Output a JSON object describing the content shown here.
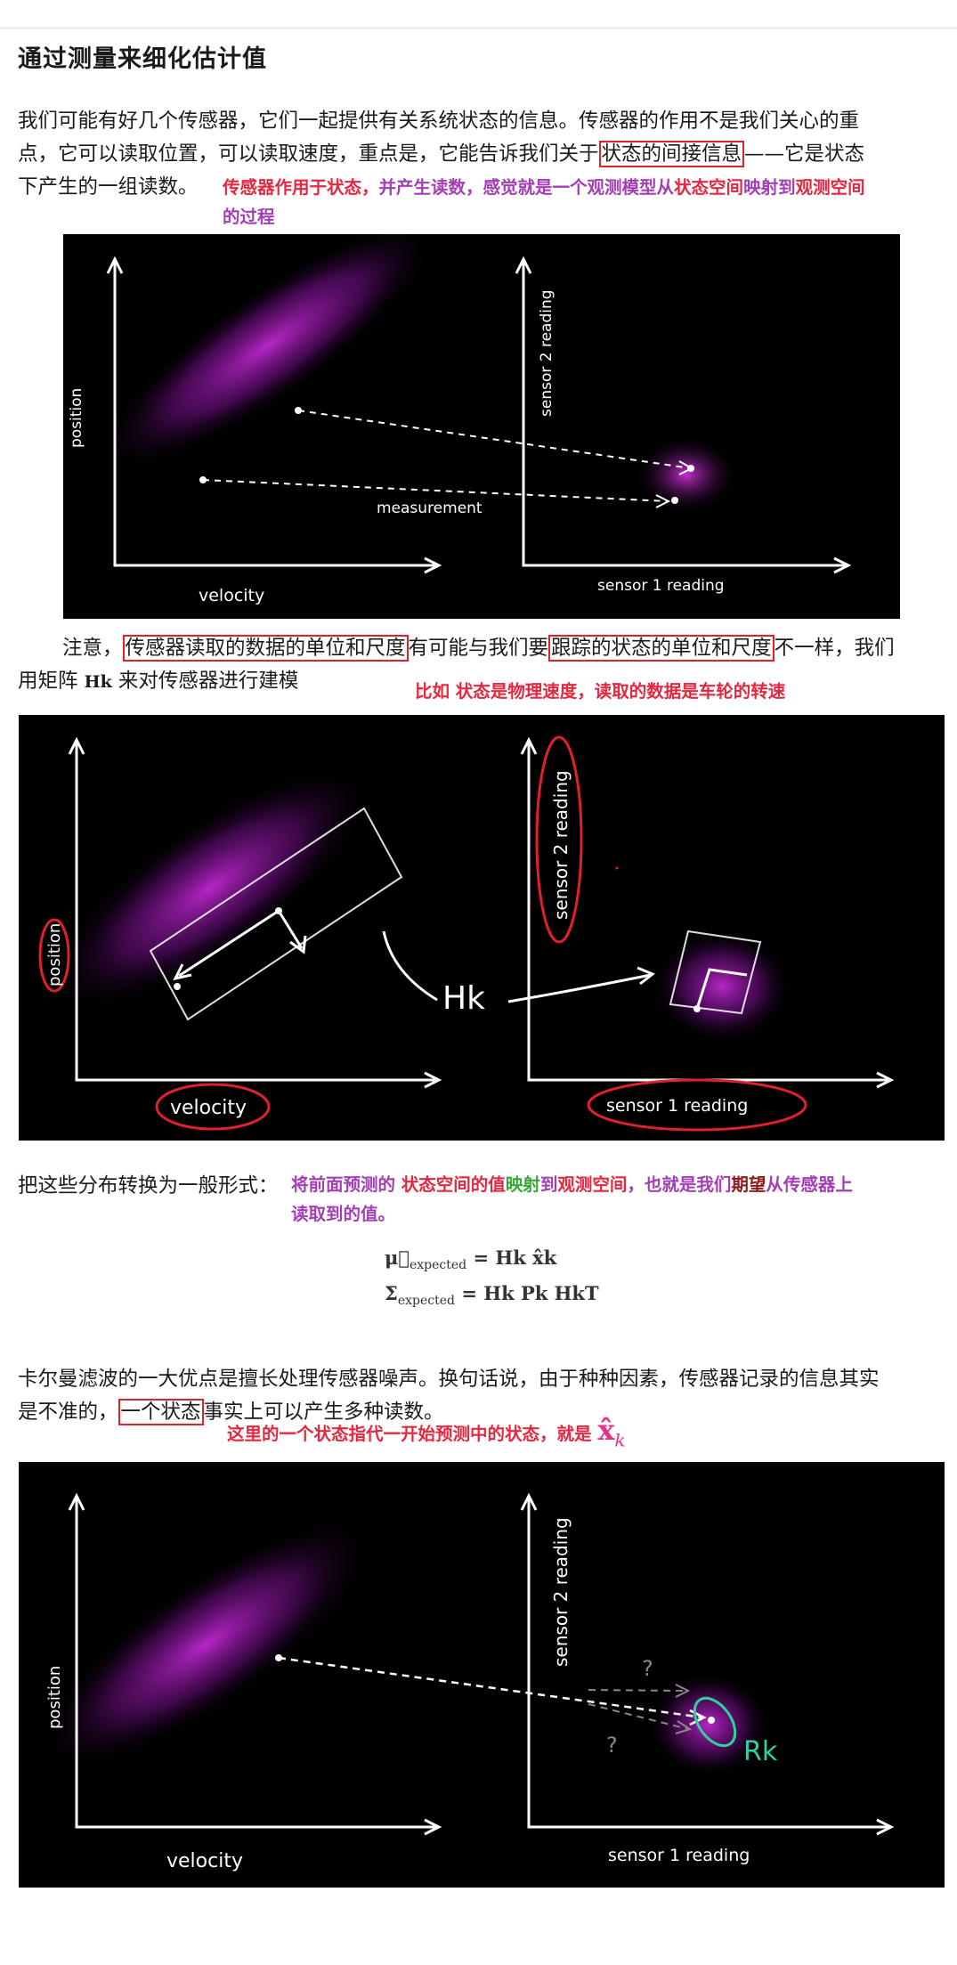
{
  "title": "通过测量来细化估计值",
  "para1": {
    "a": "我们可能有好几个传感器，它们一起提供有关系统状态的信息。传感器的作用不是我们关心的重",
    "b_pre": "点，它可以读取位置，可以读取速度，重点是，它能告诉我们关于",
    "b_box": "状态的间接信息",
    "b_post": "——它是状态",
    "c": "下产生的一组读数。"
  },
  "anno1": {
    "p1": "传感器作用于状态，",
    "p2": "并产生读数，",
    "p3": "感觉就是一个观测模型从",
    "p4": "状态空间",
    "p5": "映射到",
    "p6": "观测空间",
    "p7": "的过程"
  },
  "figure1": {
    "y_left": "position",
    "x_left": "velocity",
    "arrow_label": "measurement",
    "y_right": "sensor 2 reading",
    "x_right": "sensor 1 reading"
  },
  "para2": {
    "pre": "注意，",
    "box1": "传感器读取的数据的单位和尺度",
    "mid": "有可能与我们要",
    "box2": "跟踪的状态的单位和尺度",
    "post": "不一样，我们",
    "line2_pre": "用矩阵 ",
    "matrix": "Hk",
    "line2_post": " 来对传感器进行建模"
  },
  "anno2": "比如 状态是物理速度，读取的数据是车轮的转速",
  "figure2": {
    "y_left": "position",
    "x_left": "velocity",
    "transform_label": "Hk",
    "y_right": "sensor 2 reading",
    "x_right": "sensor 1 reading"
  },
  "para3": "把这些分布转换为一般形式：",
  "anno3": {
    "p1": "将前面预测的 ",
    "p2": "状态空间的值",
    "p3": "映射",
    "p4": "到",
    "p5": "观测空间",
    "p6": "，也就是我们",
    "p7": "期望",
    "p8": "从传感器上",
    "p9": "读取到的值。"
  },
  "equations": {
    "mu_lhs": "μ⃗",
    "mu_sub": "expected",
    "mu_rhs": "= Hk x̂k",
    "sigma_lhs": "Σ",
    "sigma_sub": "expected",
    "sigma_rhs": "= Hk Pk HkT"
  },
  "para4": {
    "a": "卡尔曼滤波的一大优点是擅长处理传感器噪声。换句话说，由于种种因素，传感器记录的信息其实",
    "b_pre": "是不准的，",
    "b_box": "一个状态",
    "b_post": "事实上可以产生多种读数。"
  },
  "anno4": {
    "text": "这里的一个状态指代一开始预测中的状态，就是",
    "symbol": "x̂",
    "sub": "k"
  },
  "figure3": {
    "y_left": "position",
    "x_left": "velocity",
    "q1": "?",
    "q2": "?",
    "noise_label": "Rk",
    "y_right": "sensor 2 reading",
    "x_right": "sensor 1 reading"
  },
  "colors": {
    "accent_red": "#e5273f",
    "accent_purple": "#a33fb5",
    "accent_green": "#35a83a",
    "box_red": "#d6252d",
    "glow": "#b020c0"
  }
}
